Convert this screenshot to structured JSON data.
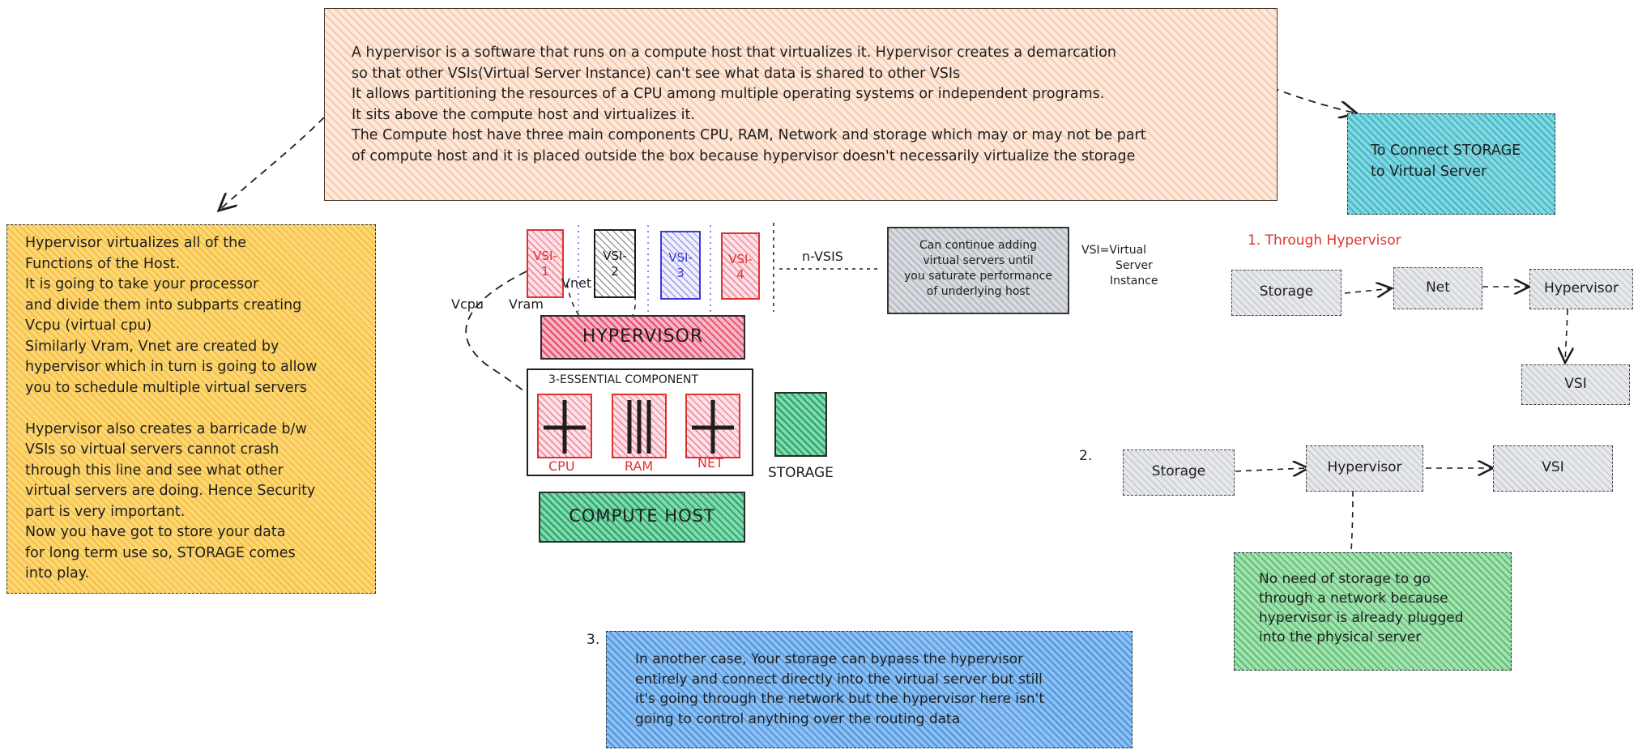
{
  "top_note": {
    "lines": [
      "A hypervisor is a software that runs on a compute host that virtualizes it. Hypervisor creates a demarcation",
      "so that other VSIs(Virtual Server Instance) can't see what data is shared to other VSIs",
      "It allows partitioning the resources of a CPU among multiple operating systems or independent programs.",
      "It sits above the compute host and virtualizes it.",
      "The Compute host have three main components CPU, RAM, Network and storage which may or may not be part",
      "of compute host and it is placed outside the box because hypervisor doesn't necessarily virtualize the storage"
    ]
  },
  "left_note": {
    "lines": [
      "Hypervisor virtualizes all of the",
      "Functions of the Host.",
      "It is going to take your processor",
      "and divide them into subparts creating",
      "Vcpu (virtual cpu)",
      "Similarly Vram, Vnet are created by",
      "hypervisor which in turn is going to allow",
      "you to schedule multiple virtual servers",
      "",
      "Hypervisor also creates a barricade b/w",
      "VSIs so virtual servers cannot crash",
      "through this line and see what other",
      "virtual servers are doing. Hence Security",
      "part is very important.",
      "Now you have got to store your data",
      "for long term use so, STORAGE comes",
      "into play."
    ]
  },
  "storage_note": {
    "lines": [
      "To Connect STORAGE",
      "to Virtual Server"
    ]
  },
  "center_diagram": {
    "vsis": [
      {
        "line1": "VSI-",
        "line2": "1",
        "color": "#e03131"
      },
      {
        "line1": "VSI-",
        "line2": "2",
        "color": "#1e1e1e"
      },
      {
        "line1": "VSI-",
        "line2": "3",
        "color": "#3b3bd6"
      },
      {
        "line1": "VSI-",
        "line2": "4",
        "color": "#e03131"
      }
    ],
    "n_vsis": "n-VSIS",
    "labels": {
      "vcpu": "Vcpu",
      "vram": "Vram",
      "vnet": "Vnet"
    },
    "hypervisor": "HYPERVISOR",
    "essential": "3-ESSENTIAL COMPONENT",
    "components": [
      "CPU",
      "RAM",
      "NET"
    ],
    "storage": "STORAGE",
    "compute_host": "COMPUTE HOST",
    "continue_note": [
      "Can continue adding",
      "virtual servers until",
      "you saturate performance",
      "of underlying host"
    ],
    "vsi_def": [
      "VSI=Virtual",
      "Server",
      "Instance"
    ]
  },
  "option1": {
    "title": "1. Through Hypervisor",
    "title_color": "#e03131",
    "nodes": [
      "Storage",
      "Net",
      "Hypervisor",
      "VSI"
    ]
  },
  "option2": {
    "num": "2.",
    "nodes": [
      "Storage",
      "Hypervisor",
      "VSI"
    ],
    "note": [
      "No need of storage to go",
      "through a network because",
      "hypervisor is already plugged",
      "into the physical server"
    ]
  },
  "option3": {
    "num": "3.",
    "note": [
      "In another case, Your storage can bypass the hypervisor",
      "entirely and connect directly into the virtual server but still",
      "it's going through the network but the hypervisor here isn't",
      "going to control anything over the routing data"
    ]
  }
}
